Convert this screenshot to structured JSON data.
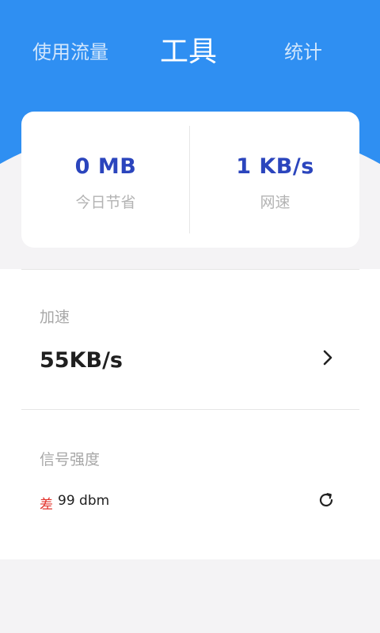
{
  "tabs": {
    "usage": "使用流量",
    "tools": "工具",
    "stats": "统计"
  },
  "stats_card": {
    "saved_today": {
      "value": "0 MB",
      "label": "今日节省"
    },
    "network_speed": {
      "value": "1 KB/s",
      "label": "网速"
    }
  },
  "acceleration": {
    "title": "加速",
    "value": "55KB/s"
  },
  "signal": {
    "title": "信号强度",
    "quality": "差",
    "dbm": "99 dbm"
  },
  "colors": {
    "header_blue": "#2f8ff2",
    "stat_value": "#2b45bd",
    "signal_bad": "#e2332c"
  },
  "icons": {
    "chevron": "chevron-right-icon",
    "refresh": "refresh-icon"
  }
}
